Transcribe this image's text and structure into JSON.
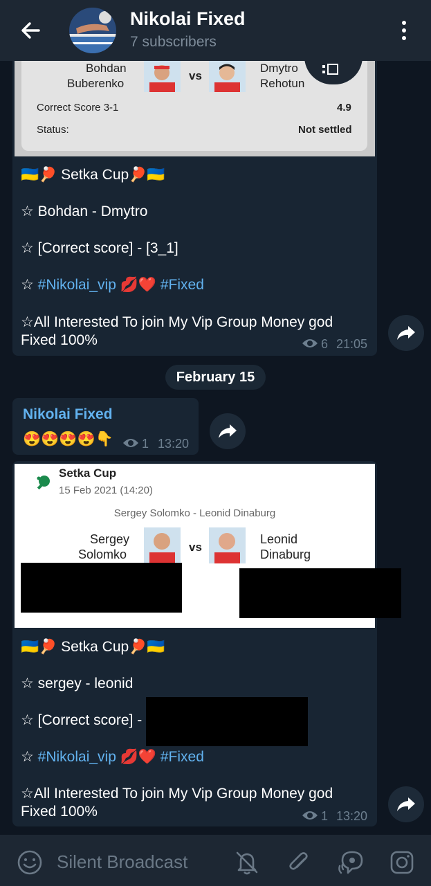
{
  "header": {
    "title": "Nikolai Fixed",
    "subtitle": "7 subscribers"
  },
  "post1": {
    "card": {
      "player1_first": "Bohdan",
      "player1_last": "Buberenko",
      "vs": "vs",
      "player2_first": "Dmytro",
      "player2_last": "Rehotun",
      "bet_label": "Correct Score 3-1",
      "bet_odds": "4.9",
      "status_label": "Status:",
      "status_value": "Not settled"
    },
    "line1": "🇺🇦🏓 Setka Cup🏓🇺🇦",
    "line2": "☆ Bohdan -  Dmytro",
    "line3": "☆ [Correct score] - [3_1]",
    "line4_star": "☆ ",
    "line4_tag1": "#Nikolai_vip",
    "line4_emoji": " 💋❤️ ",
    "line4_tag2": "#Fixed",
    "line5a": "☆All Interested To join My Vip Group Money god",
    "line5b": "Fixed 100%",
    "views": "6",
    "time": "21:05"
  },
  "date_separator": "February 15",
  "post2": {
    "author": "Nikolai Fixed",
    "emojis": "😍😍😍😍👇",
    "views": "1",
    "time": "13:20"
  },
  "post3": {
    "card": {
      "event": "Setka Cup",
      "datetime": "15 Feb 2021 (14:20)",
      "match": "Sergey Solomko - Leonid Dinaburg",
      "player1_first": "Sergey",
      "player1_last": "Solomko",
      "vs": "vs",
      "player2_first": "Leonid",
      "player2_last": "Dinaburg"
    },
    "line1": "🇺🇦🏓 Setka Cup🏓🇺🇦",
    "line2": "☆ sergey -  leonid",
    "line3": "☆ [Correct score] -",
    "line4_star": "☆ ",
    "line4_tag1": "#Nikolai_vip",
    "line4_emoji": " 💋❤️ ",
    "line4_tag2": "#Fixed",
    "line5a": "☆All Interested To join My Vip Group Money god",
    "line5b": "Fixed 100%",
    "views": "1",
    "time": "13:20"
  },
  "bottom": {
    "placeholder": "Silent Broadcast"
  },
  "colors": {
    "background": "#0e1621",
    "bubble": "#182533",
    "header": "#1d2733",
    "link": "#62b2ef",
    "meta": "#6d7f8f"
  },
  "icons": [
    "back-arrow-icon",
    "more-vertical-icon",
    "eye-icon",
    "share-icon",
    "emoji-icon",
    "bell-off-icon",
    "attach-icon",
    "voice-chat-icon",
    "camera-icon",
    "table-tennis-icon"
  ]
}
